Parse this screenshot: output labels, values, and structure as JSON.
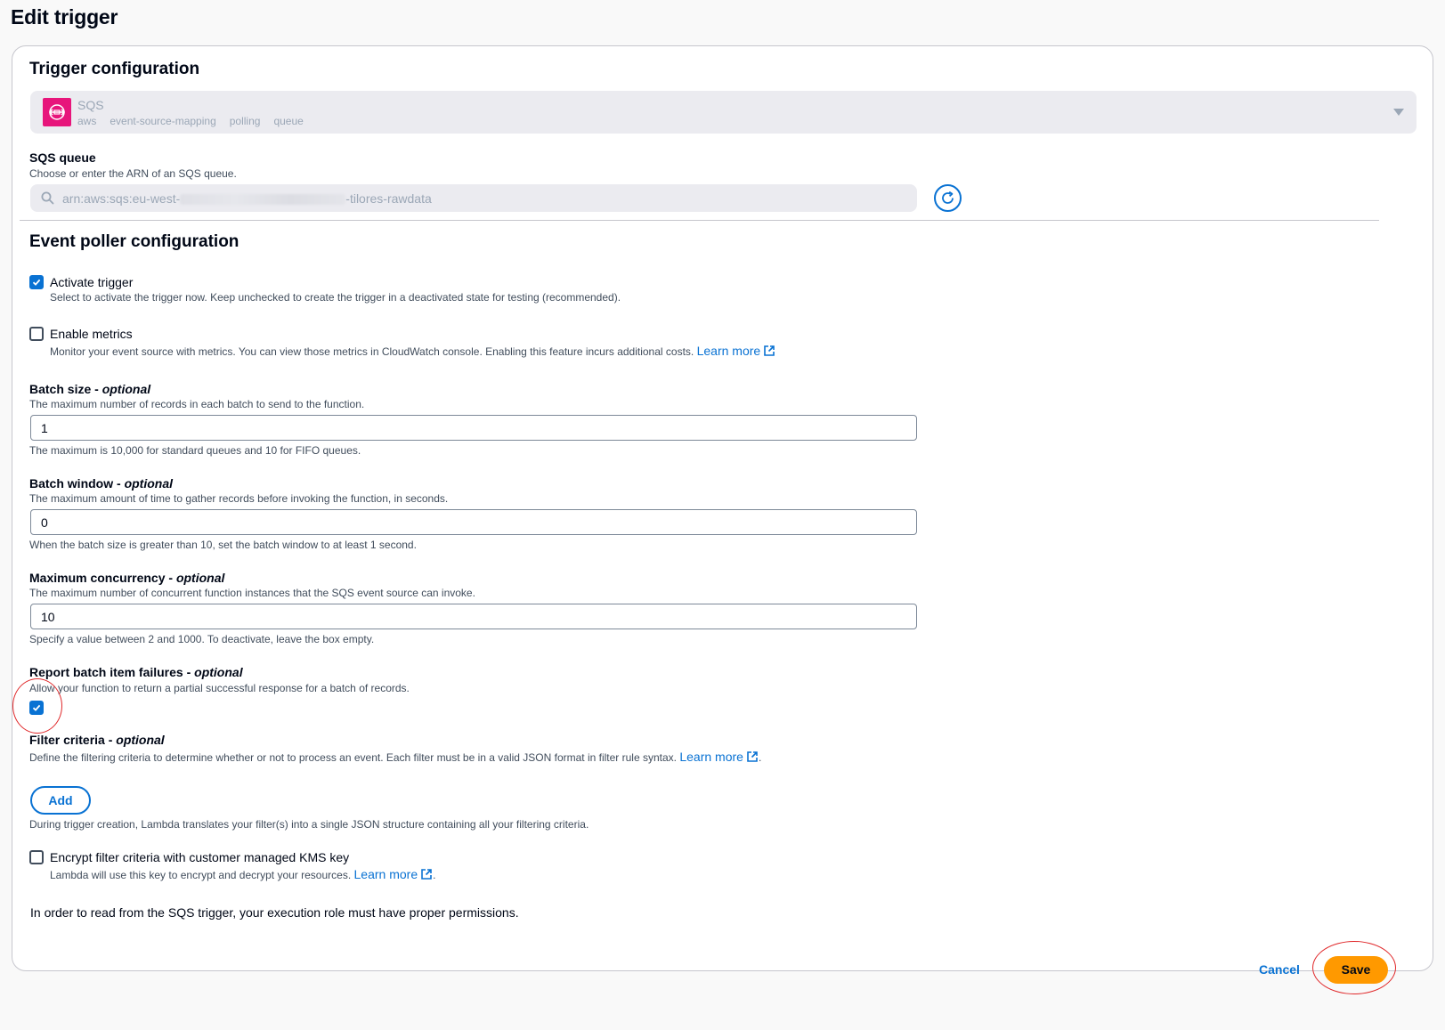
{
  "page_title": "Edit trigger",
  "trigger_config": {
    "title": "Trigger configuration",
    "source": {
      "name": "SQS",
      "tags": [
        "aws",
        "event-source-mapping",
        "polling",
        "queue"
      ],
      "icon": "sqs-logo-icon",
      "brand_color": "#e7157b"
    }
  },
  "sqs_queue": {
    "label": "SQS queue",
    "description": "Choose or enter the ARN of an SQS queue.",
    "value_prefix": "arn:aws:sqs:eu-west-",
    "value_suffix": "-tilores-rawdata"
  },
  "event_poller": {
    "title": "Event poller configuration",
    "activate_trigger": {
      "label": "Activate trigger",
      "checked": true,
      "description": "Select to activate the trigger now. Keep unchecked to create the trigger in a deactivated state for testing (recommended)."
    },
    "enable_metrics": {
      "label": "Enable metrics",
      "checked": false,
      "description": "Monitor your event source with metrics. You can view those metrics in CloudWatch console. Enabling this feature incurs additional costs.",
      "link": "Learn more"
    },
    "batch_size": {
      "label": "Batch size - ",
      "label_optional": "optional",
      "description": "The maximum number of records in each batch to send to the function.",
      "value": "1",
      "hint": "The maximum is 10,000 for standard queues and 10 for FIFO queues."
    },
    "batch_window": {
      "label": "Batch window - ",
      "label_optional": "optional",
      "description": "The maximum amount of time to gather records before invoking the function, in seconds.",
      "value": "0",
      "hint": "When the batch size is greater than 10, set the batch window to at least 1 second."
    },
    "max_concurrency": {
      "label": "Maximum concurrency - ",
      "label_optional": "optional",
      "description": "The maximum number of concurrent function instances that the SQS event source can invoke.",
      "value": "10",
      "hint": "Specify a value between 2 and 1000. To deactivate, leave the box empty."
    },
    "report_batch_failures": {
      "label": "Report batch item failures - ",
      "label_optional": "optional",
      "description": "Allow your function to return a partial successful response for a batch of records.",
      "checked": true
    },
    "filter_criteria": {
      "label": "Filter criteria - ",
      "label_optional": "optional",
      "description": "Define the filtering criteria to determine whether or not to process an event. Each filter must be in a valid JSON format in filter rule syntax.",
      "link": "Learn more",
      "add_label": "Add",
      "hint": "During trigger creation, Lambda translates your filter(s) into a single JSON structure containing all your filtering criteria."
    },
    "encrypt_filter": {
      "label": "Encrypt filter criteria with customer managed KMS key",
      "checked": false,
      "description": "Lambda will use this key to encrypt and decrypt your resources.",
      "link": "Learn more"
    },
    "permissions_note": "In order to read from the SQS trigger, your execution role must have proper permissions."
  },
  "footer": {
    "cancel_label": "Cancel",
    "save_label": "Save"
  },
  "colors": {
    "accent": "#0972d3",
    "primary_button": "#ff9900",
    "annotation": "#e0282a"
  }
}
